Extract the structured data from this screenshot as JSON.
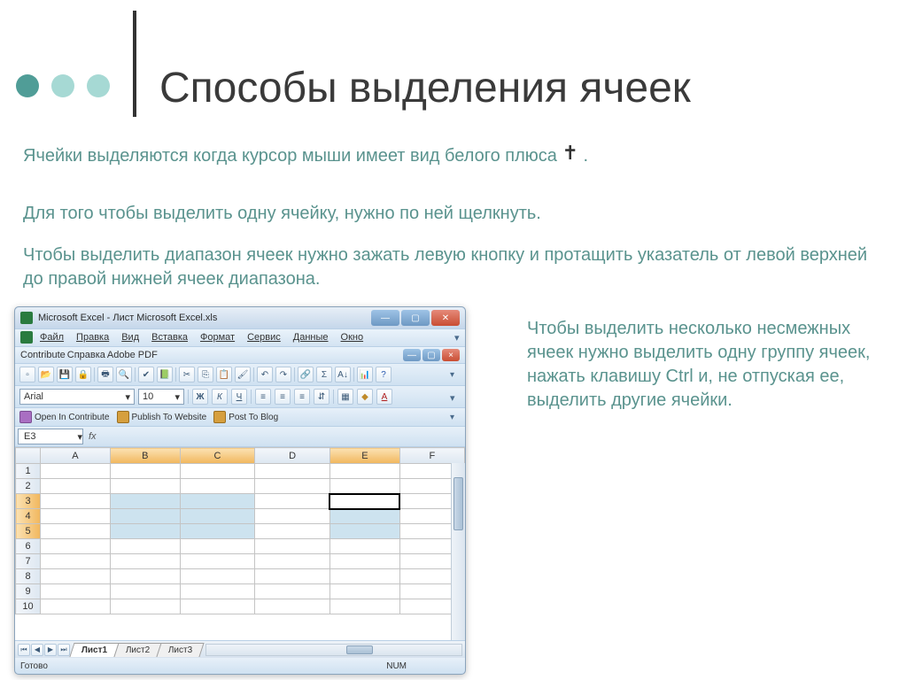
{
  "theme": {
    "dot_dark": "#509d97",
    "dot_light": "#a6d9d4",
    "text_green": "#5a938e"
  },
  "title": "Способы выделения ячеек",
  "para1_a": "Ячейки выделяются когда курсор мыши имеет вид белого плюса ",
  "para1_b": ".",
  "para2": "Для того чтобы выделить одну ячейку, нужно по ней щелкнуть.",
  "para3": "Чтобы выделить диапазон ячеек нужно зажать левую кнопку и протащить указатель от левой верхней до правой нижней ячеек диапазона.",
  "para4": "Чтобы выделить несколько несмежных ячеек нужно выделить одну группу ячеек, нажать клавишу Ctrl и, не отпуская ее, выделить другие ячейки.",
  "excel": {
    "window_title": "Microsoft Excel - Лист Microsoft Excel.xls",
    "menu": [
      "Файл",
      "Правка",
      "Вид",
      "Вставка",
      "Формат",
      "Сервис",
      "Данные",
      "Окно"
    ],
    "menu2": [
      "Contribute",
      "Справка",
      "Adobe PDF"
    ],
    "font_name": "Arial",
    "font_size": "10",
    "bold": "Ж",
    "italic": "К",
    "underline": "Ч",
    "letterA": "A",
    "contribute": {
      "open": "Open In Contribute",
      "publish": "Publish To Website",
      "post": "Post To Blog"
    },
    "namebox": "E3",
    "fx": "fx",
    "columns": [
      "",
      "A",
      "B",
      "C",
      "D",
      "E",
      "F"
    ],
    "selected_cols": [
      "B",
      "C",
      "E"
    ],
    "rows": [
      "1",
      "2",
      "3",
      "4",
      "5",
      "6",
      "7",
      "8",
      "9",
      "10"
    ],
    "selected_rows": [
      "3",
      "4",
      "5"
    ],
    "active_cell": "E3",
    "tabs": [
      "Лист1",
      "Лист2",
      "Лист3"
    ],
    "status_left": "Готово",
    "status_num": "NUM"
  },
  "chart_data": {
    "type": "table",
    "title": "Excel cell selection example",
    "columns": [
      "A",
      "B",
      "C",
      "D",
      "E",
      "F"
    ],
    "rows": 10,
    "selected_range_1": "B3:C5",
    "selected_range_2": "E3:E5",
    "active_cell": "E3"
  }
}
